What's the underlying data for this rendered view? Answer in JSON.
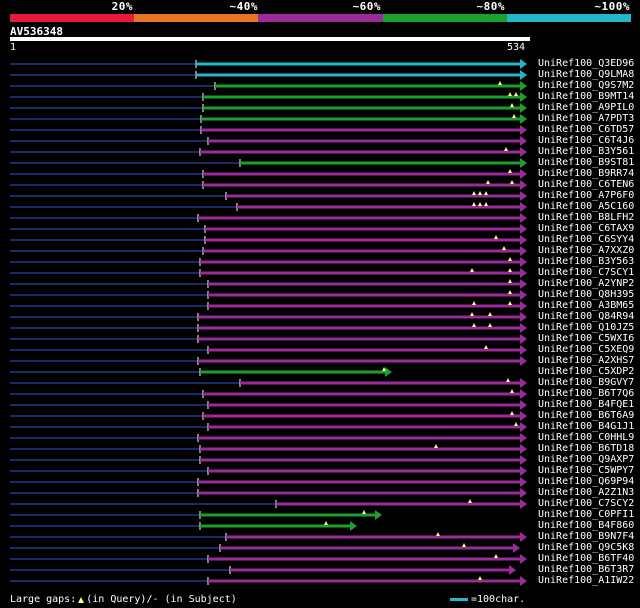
{
  "legend": {
    "percents": [
      "20%",
      "~40%",
      "~60%",
      "~80%",
      "~100%"
    ],
    "colors": [
      "#e8193a",
      "#e67722",
      "#9b2a9a",
      "#1ba12a",
      "#20b8c9"
    ]
  },
  "query": {
    "id": "AV536348",
    "start": "1",
    "end": "534"
  },
  "footer": {
    "gaps_prefix": "Large gaps:",
    "gaps_query": "(in Query)/",
    "gaps_subject": "- (in Subject)",
    "scale_label": "=100char."
  },
  "hits": [
    {
      "label": "UniRef100_Q3ED96",
      "start": 196,
      "color": "#20b8c9",
      "end": 527,
      "marks": []
    },
    {
      "label": "UniRef100_Q9LMA8",
      "start": 196,
      "color": "#20b8c9",
      "end": 527,
      "marks": []
    },
    {
      "label": "UniRef100_Q9S7M2",
      "start": 215,
      "color": "#1ba12a",
      "end": 527,
      "marks": [
        500
      ]
    },
    {
      "label": "UniRef100_B9MT14",
      "start": 203,
      "color": "#1ba12a",
      "end": 527,
      "marks": [
        510,
        516
      ]
    },
    {
      "label": "UniRef100_A9PIL0",
      "start": 203,
      "color": "#1ba12a",
      "end": 527,
      "marks": [
        512
      ]
    },
    {
      "label": "UniRef100_A7PDT3",
      "start": 201,
      "color": "#1ba12a",
      "end": 527,
      "marks": [
        514
      ]
    },
    {
      "label": "UniRef100_C6TD57",
      "start": 201,
      "color": "#9b2a9a",
      "end": 527,
      "marks": []
    },
    {
      "label": "UniRef100_C6T4J6",
      "start": 208,
      "color": "#9b2a9a",
      "end": 527,
      "marks": []
    },
    {
      "label": "UniRef100_B3Y561",
      "start": 200,
      "color": "#9b2a9a",
      "end": 527,
      "marks": [
        506
      ]
    },
    {
      "label": "UniRef100_B9ST81",
      "start": 240,
      "color": "#1ba12a",
      "end": 527,
      "marks": []
    },
    {
      "label": "UniRef100_B9RR74",
      "start": 203,
      "color": "#9b2a9a",
      "end": 527,
      "marks": [
        510
      ]
    },
    {
      "label": "UniRef100_C6TEN6",
      "start": 203,
      "color": "#9b2a9a",
      "end": 527,
      "marks": [
        488,
        512
      ]
    },
    {
      "label": "UniRef100_A7P6F0",
      "start": 226,
      "color": "#9b2a9a",
      "end": 527,
      "marks": [
        474,
        480,
        486
      ]
    },
    {
      "label": "UniRef100_A5C160",
      "start": 237,
      "color": "#9b2a9a",
      "end": 527,
      "marks": [
        474,
        480,
        486
      ]
    },
    {
      "label": "UniRef100_B8LFH2",
      "start": 198,
      "color": "#9b2a9a",
      "end": 527,
      "marks": []
    },
    {
      "label": "UniRef100_C6TAX9",
      "start": 205,
      "color": "#9b2a9a",
      "end": 527,
      "marks": []
    },
    {
      "label": "UniRef100_C6SYY4",
      "start": 205,
      "color": "#9b2a9a",
      "end": 527,
      "marks": [
        496
      ]
    },
    {
      "label": "UniRef100_A7XXZ0",
      "start": 203,
      "color": "#9b2a9a",
      "end": 527,
      "marks": [
        504
      ]
    },
    {
      "label": "UniRef100_B3Y563",
      "start": 200,
      "color": "#9b2a9a",
      "end": 527,
      "marks": [
        510
      ]
    },
    {
      "label": "UniRef100_C7SCY1",
      "start": 200,
      "color": "#9b2a9a",
      "end": 527,
      "marks": [
        472,
        510
      ]
    },
    {
      "label": "UniRef100_A2YNP2",
      "start": 208,
      "color": "#9b2a9a",
      "end": 527,
      "marks": [
        510
      ]
    },
    {
      "label": "UniRef100_Q8H395",
      "start": 208,
      "color": "#9b2a9a",
      "end": 527,
      "marks": [
        510
      ]
    },
    {
      "label": "UniRef100_A3BM65",
      "start": 208,
      "color": "#9b2a9a",
      "end": 527,
      "marks": [
        474,
        510
      ]
    },
    {
      "label": "UniRef100_Q84R94",
      "start": 198,
      "color": "#9b2a9a",
      "end": 527,
      "marks": [
        472,
        490
      ]
    },
    {
      "label": "UniRef100_Q10JZ5",
      "start": 198,
      "color": "#9b2a9a",
      "end": 527,
      "marks": [
        474,
        490
      ]
    },
    {
      "label": "UniRef100_C5WXI6",
      "start": 198,
      "color": "#9b2a9a",
      "end": 527,
      "marks": []
    },
    {
      "label": "UniRef100_C5XEQ9",
      "start": 208,
      "color": "#9b2a9a",
      "end": 527,
      "marks": [
        486
      ]
    },
    {
      "label": "UniRef100_A2XHS7",
      "start": 198,
      "color": "#9b2a9a",
      "end": 527,
      "marks": []
    },
    {
      "label": "UniRef100_C5XDP2",
      "start": 200,
      "color": "#1ba12a",
      "end": 392,
      "marks": [
        384
      ]
    },
    {
      "label": "UniRef100_B9GVY7",
      "start": 240,
      "color": "#9b2a9a",
      "end": 527,
      "marks": [
        508
      ]
    },
    {
      "label": "UniRef100_B6T7Q6",
      "start": 203,
      "color": "#9b2a9a",
      "end": 527,
      "marks": [
        512
      ]
    },
    {
      "label": "UniRef100_B4FQE1",
      "start": 208,
      "color": "#9b2a9a",
      "end": 527,
      "marks": []
    },
    {
      "label": "UniRef100_B6T6A9",
      "start": 203,
      "color": "#9b2a9a",
      "end": 527,
      "marks": [
        512
      ]
    },
    {
      "label": "UniRef100_B4G1J1",
      "start": 208,
      "color": "#9b2a9a",
      "end": 527,
      "marks": [
        516
      ]
    },
    {
      "label": "UniRef100_C0HHL9",
      "start": 198,
      "color": "#9b2a9a",
      "end": 527,
      "marks": []
    },
    {
      "label": "UniRef100_B6TD18",
      "start": 200,
      "color": "#9b2a9a",
      "end": 527,
      "marks": [
        436
      ]
    },
    {
      "label": "UniRef100_Q9AXP7",
      "start": 200,
      "color": "#9b2a9a",
      "end": 527,
      "marks": []
    },
    {
      "label": "UniRef100_C5WPY7",
      "start": 208,
      "color": "#9b2a9a",
      "end": 527,
      "marks": []
    },
    {
      "label": "UniRef100_Q69P94",
      "start": 198,
      "color": "#9b2a9a",
      "end": 527,
      "marks": []
    },
    {
      "label": "UniRef100_A2Z1N3",
      "start": 198,
      "color": "#9b2a9a",
      "end": 527,
      "marks": []
    },
    {
      "label": "UniRef100_C7SCY2",
      "start": 276,
      "color": "#9b2a9a",
      "end": 527,
      "marks": [
        470
      ]
    },
    {
      "label": "UniRef100_C0PFI1",
      "start": 200,
      "color": "#1ba12a",
      "end": 382,
      "marks": [
        364
      ]
    },
    {
      "label": "UniRef100_B4F860",
      "start": 200,
      "color": "#1ba12a",
      "end": 357,
      "marks": [
        326
      ]
    },
    {
      "label": "UniRef100_B9N7F4",
      "start": 226,
      "color": "#9b2a9a",
      "end": 527,
      "marks": [
        438
      ]
    },
    {
      "label": "UniRef100_Q9C5K8",
      "start": 220,
      "color": "#9b2a9a",
      "end": 520,
      "marks": [
        464
      ]
    },
    {
      "label": "UniRef100_B6TF40",
      "start": 208,
      "color": "#9b2a9a",
      "end": 527,
      "marks": [
        496
      ]
    },
    {
      "label": "UniRef100_B6T3R7",
      "start": 230,
      "color": "#9b2a9a",
      "end": 516,
      "marks": []
    },
    {
      "label": "UniRef100_A1IW22",
      "start": 208,
      "color": "#9b2a9a",
      "end": 527,
      "marks": [
        480
      ]
    }
  ]
}
